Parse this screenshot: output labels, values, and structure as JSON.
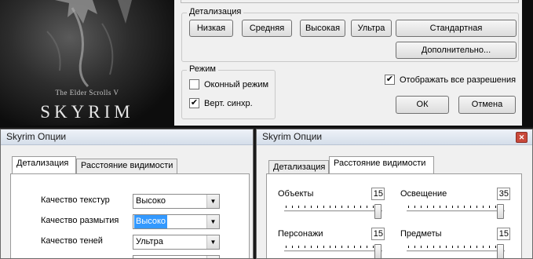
{
  "launcher": {
    "art": {
      "subtitle": "The Elder Scrolls V",
      "title": "SKYRIM"
    },
    "detail_group": {
      "legend": "Детализация",
      "buttons": {
        "low": "Низкая",
        "medium": "Средняя",
        "high": "Высокая",
        "ultra": "Ультра",
        "standard": "Стандартная",
        "advanced": "Дополнительно..."
      }
    },
    "mode_group": {
      "legend": "Режим",
      "windowed": {
        "label": "Оконный режим",
        "checked": false
      },
      "vsync": {
        "label": "Верт. синхр.",
        "checked": true
      }
    },
    "show_all_res": {
      "label": "Отображать все разрешения",
      "checked": true
    },
    "ok": "ОК",
    "cancel": "Отмена"
  },
  "dialog_left": {
    "title": "Skyrim  Опции",
    "tabs": [
      "Детализация",
      "Расстояние видимости"
    ],
    "active_tab": 0,
    "rows": [
      {
        "label": "Качество текстур",
        "value": "Высоко"
      },
      {
        "label": "Качество размытия",
        "value": "Высоко",
        "selected": true
      },
      {
        "label": "Качество теней",
        "value": "Ультра"
      },
      {
        "label": "",
        "value": ""
      }
    ]
  },
  "dialog_right": {
    "title": "Skyrim  Опции",
    "close_icon": "close-icon",
    "tabs": [
      "Детализация",
      "Расстояние видимости"
    ],
    "active_tab": 1,
    "sliders": [
      {
        "label": "Объекты",
        "value": "15",
        "level": 1.0
      },
      {
        "label": "Освещение",
        "value": "35",
        "level": 1.0
      },
      {
        "label": "Персонажи",
        "value": "15",
        "level": 1.0
      },
      {
        "label": "Предметы",
        "value": "15",
        "level": 1.0
      }
    ]
  },
  "colors": {
    "accent_selection": "#3399ff",
    "close_button": "#c9483a"
  }
}
